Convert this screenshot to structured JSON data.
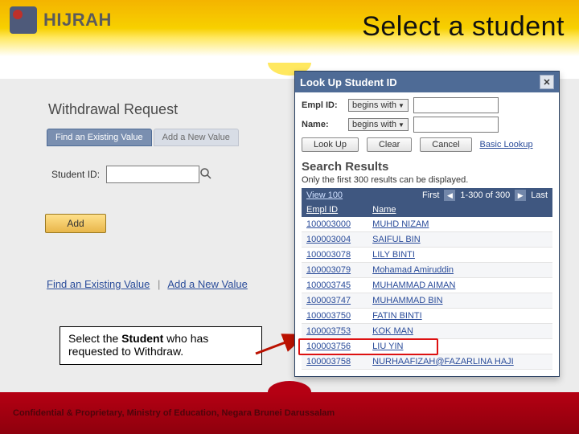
{
  "header": {
    "logo_text": "HIJRAH",
    "title": "Select a student"
  },
  "left": {
    "section_title": "Withdrawal Request",
    "tabs": {
      "active": "Find an Existing Value",
      "inactive": "Add a New Value"
    },
    "student_id_label": "Student ID:",
    "add_label": "Add",
    "links": {
      "find": "Find an Existing Value",
      "add": "Add a New Value"
    }
  },
  "callout": {
    "prefix": "Select the ",
    "bold": "Student",
    "suffix": " who has requested to Withdraw."
  },
  "popup": {
    "title": "Look Up Student ID",
    "empl_label": "Empl ID:",
    "name_label": "Name:",
    "op": "begins with",
    "buttons": {
      "lookup": "Look Up",
      "clear": "Clear",
      "cancel": "Cancel"
    },
    "basic_link": "Basic Lookup",
    "search_results": "Search Results",
    "note": "Only the first 300 results can be displayed.",
    "nav": {
      "view100": "View 100",
      "first": "First",
      "range": "1-300 of 300",
      "last": "Last"
    },
    "columns": {
      "id": "Empl ID",
      "name": "Name"
    },
    "rows": [
      {
        "id": "100003000",
        "name": "MUHD NIZAM"
      },
      {
        "id": "100003004",
        "name": "SAIFUL BIN"
      },
      {
        "id": "100003078",
        "name": "LILY BINTI"
      },
      {
        "id": "100003079",
        "name": "Mohamad Amiruddin"
      },
      {
        "id": "100003745",
        "name": "MUHAMMAD AIMAN"
      },
      {
        "id": "100003747",
        "name": "MUHAMMAD BIN"
      },
      {
        "id": "100003750",
        "name": "FATIN BINTI"
      },
      {
        "id": "100003753",
        "name": "KOK MAN"
      },
      {
        "id": "100003756",
        "name": "LIU YIN"
      },
      {
        "id": "100003758",
        "name": "NURHAAFIZAH@FAZARLINA HAJI"
      }
    ],
    "highlight_row": 8
  },
  "footer": {
    "text": "Confidential & Proprietary, Ministry of Education, Negara Brunei Darussalam"
  }
}
